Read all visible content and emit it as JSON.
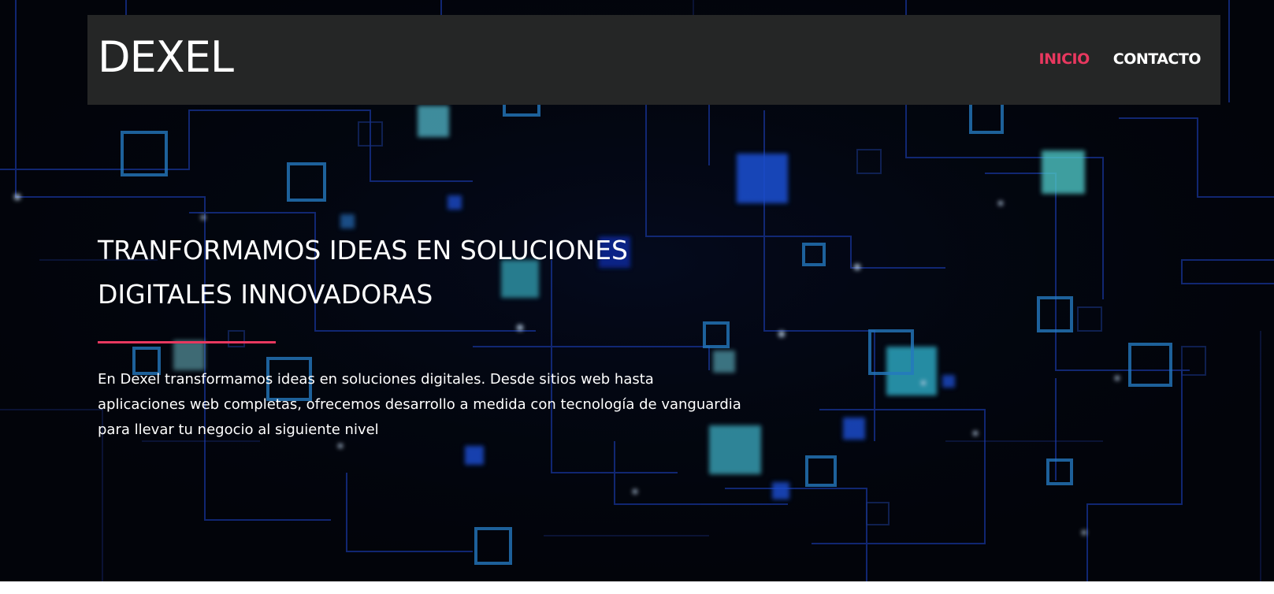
{
  "colors": {
    "accent": "#e8385f",
    "navbar_bg": "#252626",
    "hero_bg": "#03050c"
  },
  "header": {
    "logo": "DEXEL",
    "nav": [
      {
        "label": "INICIO",
        "active": true
      },
      {
        "label": "CONTACTO",
        "active": false
      }
    ]
  },
  "hero": {
    "headline_line1": "TRANFORMAMOS IDEAS EN SOLUCIONES",
    "headline_line2": "DIGITALES INNOVADORAS",
    "description": "En Dexel transformamos ideas en soluciones digitales. Desde sitios web hasta aplicaciones web completas, ofrecemos desarrollo a medida con tecnología de vanguardia para llevar tu negocio al siguiente nivel"
  }
}
